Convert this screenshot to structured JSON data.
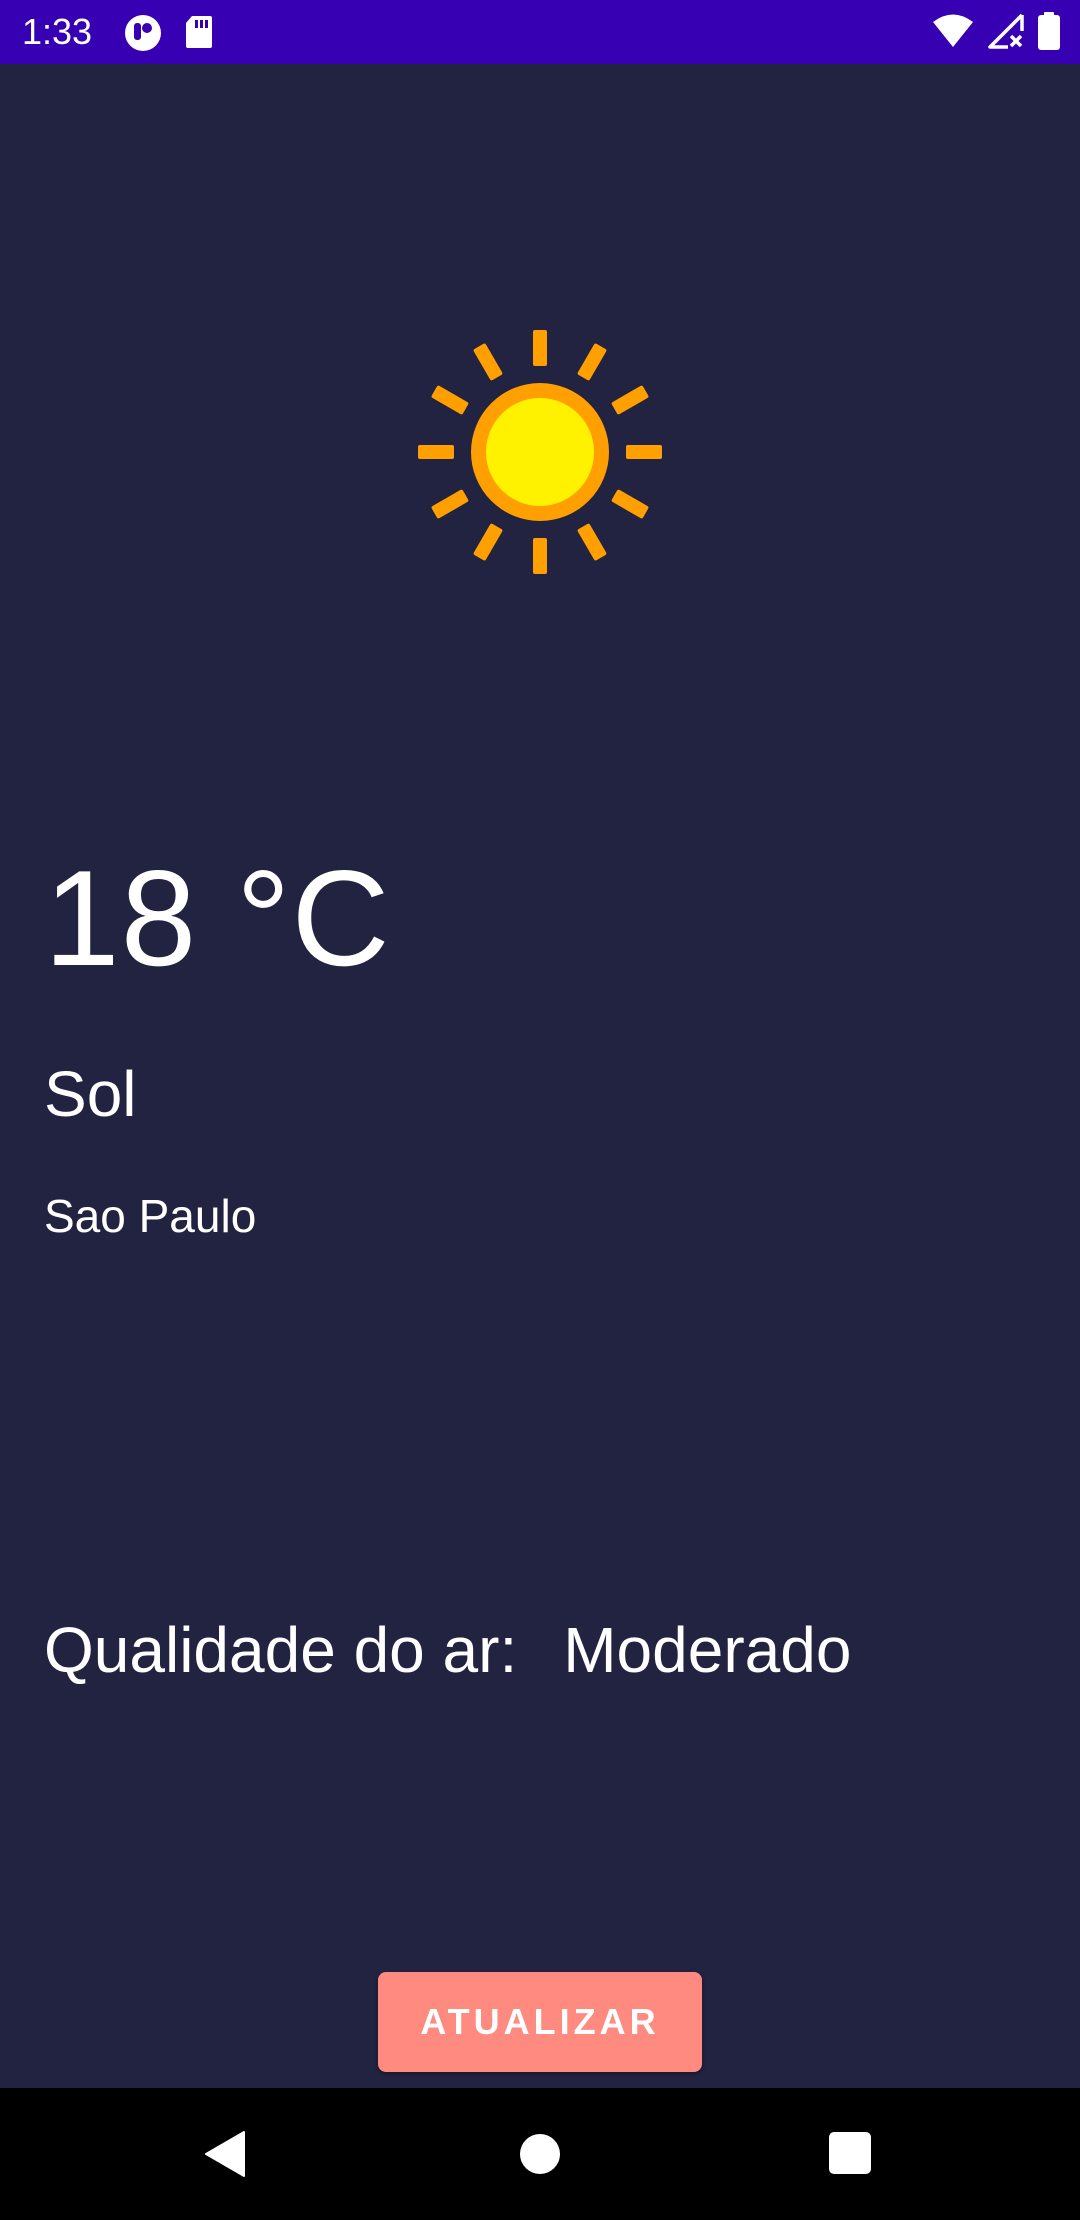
{
  "status_bar": {
    "time": "1:33",
    "background": "#3700b3",
    "left_icons": [
      "app-notification-icon",
      "sd-card-icon"
    ],
    "right_icons": [
      "wifi-icon",
      "cellular-no-signal-icon",
      "battery-icon"
    ]
  },
  "weather": {
    "icon": "sun-icon",
    "temperature": "18 °C",
    "condition": "Sol",
    "city": "Sao Paulo"
  },
  "air_quality": {
    "label": "Qualidade do ar:",
    "value": "Moderado"
  },
  "refresh_button": {
    "label": "ATUALIZAR",
    "color": "#ff8a80"
  },
  "nav_bar": {
    "buttons": [
      "back-icon",
      "home-icon",
      "recents-icon"
    ]
  },
  "colors": {
    "background": "#222340",
    "sun_ray": "#ffa000",
    "sun_core": "#fff200"
  }
}
